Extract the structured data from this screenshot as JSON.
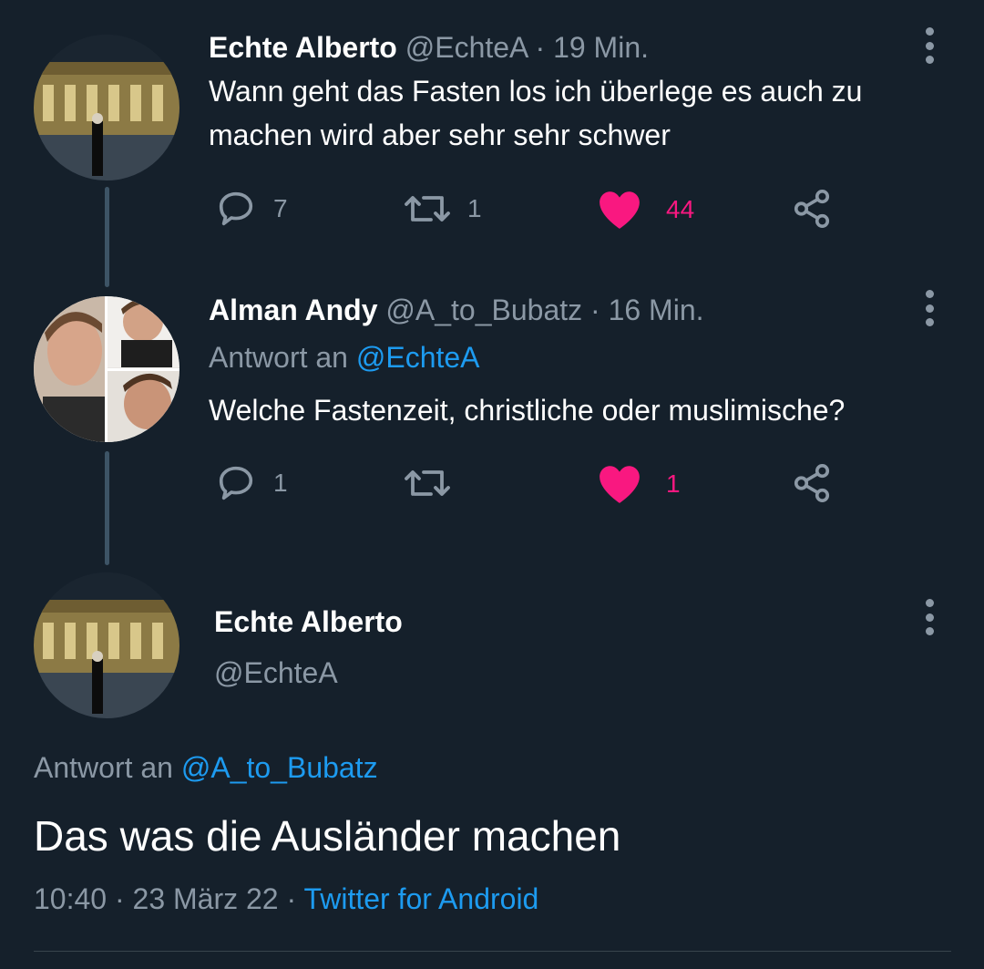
{
  "tweet1": {
    "name": "Echte Alberto",
    "handle": "@EchteA",
    "time": "· 19 Min.",
    "text": "Wann geht das Fasten los ich überlege es auch zu machen wird aber sehr sehr schwer",
    "replies": "7",
    "retweets": "1",
    "likes": "44"
  },
  "tweet2": {
    "name": "Alman Andy",
    "handle": "@A_to_Bubatz",
    "time": "· 16 Min.",
    "reply_prefix": "Antwort an",
    "reply_handle": "@EchteA",
    "text": "Welche Fastenzeit, christliche oder muslimische?",
    "replies": "1",
    "retweets": "",
    "likes": "1"
  },
  "main": {
    "name": "Echte Alberto",
    "handle": "@EchteA",
    "reply_prefix": "Antwort an",
    "reply_handle": "@A_to_Bubatz",
    "text": "Das was die Ausländer machen",
    "time": "10:40 · 23 März 22 ·",
    "source": "Twitter for Android"
  },
  "colors": {
    "background": "#15202b",
    "muted": "#8b98a5",
    "link": "#1d9bf0",
    "like": "#f91880"
  },
  "icons": [
    "reply-icon",
    "retweet-icon",
    "heart-icon",
    "share-icon",
    "more-icon"
  ]
}
